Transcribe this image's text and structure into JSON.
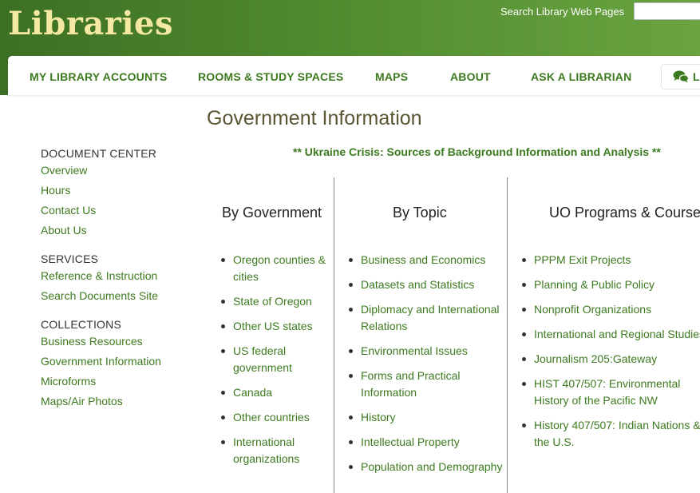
{
  "header": {
    "logo_text": "Libraries",
    "search_label": "Search Library Web Pages",
    "search_value": ""
  },
  "nav": {
    "items": [
      {
        "label": "MY LIBRARY ACCOUNTS"
      },
      {
        "label": "ROOMS & STUDY SPACES"
      },
      {
        "label": "MAPS"
      },
      {
        "label": "ABOUT"
      },
      {
        "label": "ASK A LIBRARIAN"
      }
    ],
    "live_chat_label": "Live"
  },
  "page": {
    "title": "Government Information",
    "notice": "** Ukraine Crisis: Sources of Background Information and Analysis **"
  },
  "sidebar": {
    "sections": [
      {
        "heading": "DOCUMENT CENTER",
        "links": [
          "Overview",
          "Hours",
          "Contact Us",
          "About Us"
        ]
      },
      {
        "heading": "SERVICES",
        "links": [
          "Reference & Instruction",
          "Search Documents Site"
        ]
      },
      {
        "heading": "COLLECTIONS",
        "links": [
          "Business Resources",
          "Government Information",
          "Microforms",
          "Maps/Air Photos"
        ]
      }
    ]
  },
  "columns": [
    {
      "heading": "By Government",
      "items": [
        "Oregon counties & cities",
        "State of Oregon",
        "Other US states",
        "US federal government",
        "Canada",
        "Other countries",
        "International organizations"
      ]
    },
    {
      "heading": "By Topic",
      "items": [
        "Business and Economics",
        "Datasets and Statistics",
        "Diplomacy and International Relations",
        "Environmental Issues",
        "Forms and Practical Information",
        "History",
        "Intellectual Property",
        "Population and Demography"
      ]
    },
    {
      "heading": "UO Programs & Courses",
      "items": [
        "PPPM Exit Projects",
        "Planning & Public Policy",
        "Nonprofit Organizations",
        "International and Regional Studies",
        "Journalism 205:Gateway",
        "HIST 407/507: Environmental History of the Pacific NW",
        "History 407/507: Indian Nations & the U.S."
      ]
    }
  ],
  "colors": {
    "header_green": "#4f8a2e",
    "logo_cream": "#f5e8a3",
    "link_green": "#3d7a1f",
    "title_olive": "#5a5532"
  }
}
